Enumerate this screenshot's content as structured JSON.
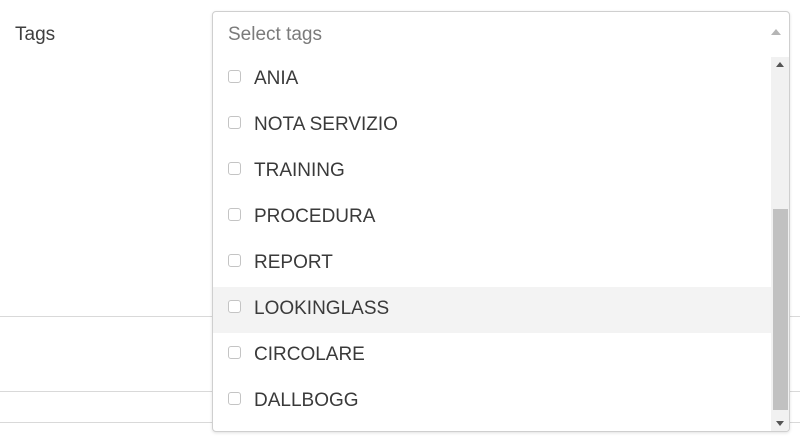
{
  "form": {
    "tags_label": "Tags"
  },
  "tags_select": {
    "placeholder": "Select tags",
    "options": [
      {
        "label": "ANIA",
        "checked": false
      },
      {
        "label": "NOTA SERVIZIO",
        "checked": false
      },
      {
        "label": "TRAINING",
        "checked": false
      },
      {
        "label": "PROCEDURA",
        "checked": false
      },
      {
        "label": "REPORT",
        "checked": false
      },
      {
        "label": "LOOKINGLASS",
        "checked": false,
        "hovered": true
      },
      {
        "label": "CIRCOLARE",
        "checked": false
      },
      {
        "label": "DALLBOGG",
        "checked": false
      }
    ]
  },
  "colors": {
    "hover_row": "#f3f3f3",
    "scroll_thumb": "#c1c1c1"
  }
}
